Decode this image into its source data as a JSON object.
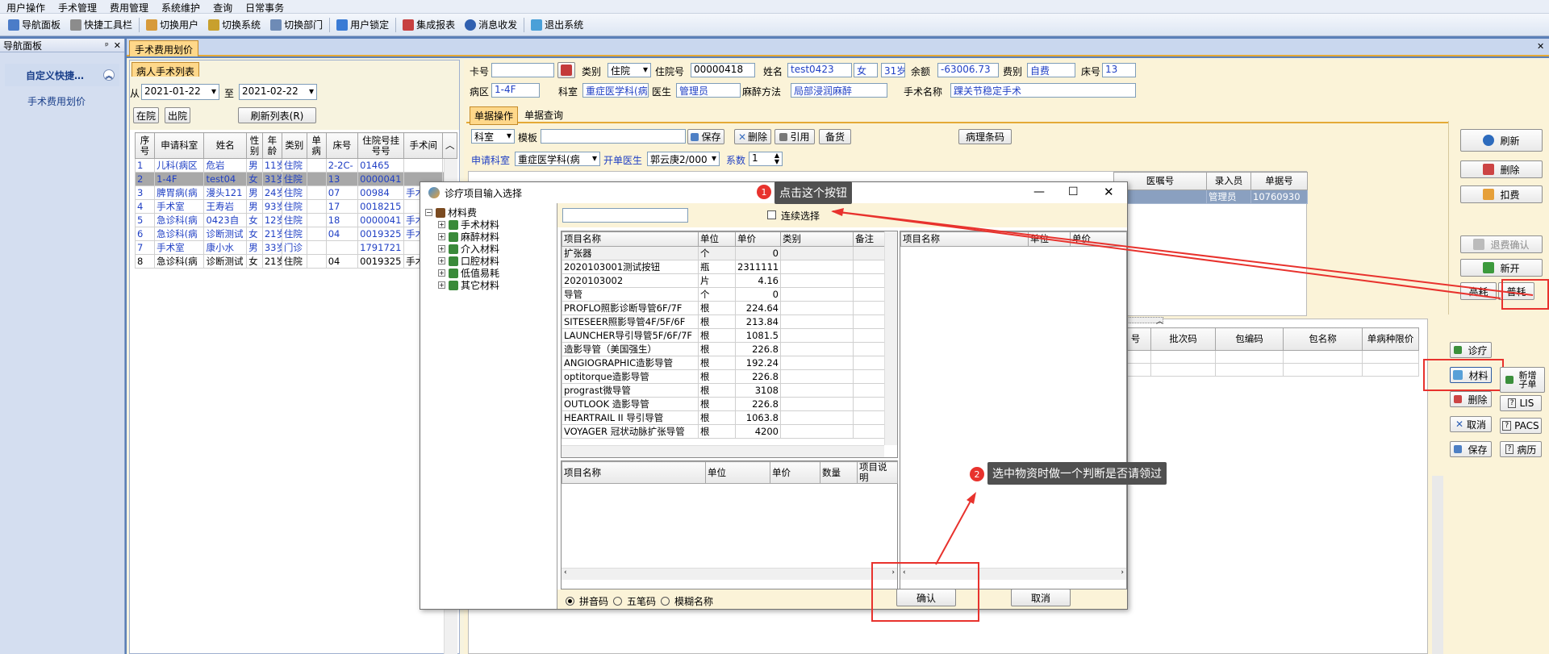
{
  "menu": [
    "用户操作",
    "手术管理",
    "费用管理",
    "系统维护",
    "查询",
    "日常事务"
  ],
  "toolbar": [
    "导航面板",
    "快捷工具栏",
    "切换用户",
    "切换系统",
    "切换部门",
    "用户锁定",
    "集成报表",
    "消息收发",
    "退出系统"
  ],
  "nav": {
    "title": "导航面板",
    "pin": "ᵖ",
    "close": "✕",
    "group": "自定义快捷…",
    "item": "手术费用划价"
  },
  "main_tab": "手术费用划价",
  "left": {
    "tab": "病人手术列表",
    "from_label": "从",
    "from_date": "2021-01-22",
    "to_label": "至",
    "to_date": "2021-02-22",
    "btn_inpatient": "在院",
    "btn_discharged": "出院",
    "btn_refresh": "刷新列表(R)",
    "columns": [
      "序号",
      "申请科室",
      "姓名",
      "性别",
      "年龄",
      "类别",
      "单病",
      "床号",
      "住院号挂号号",
      "手术间"
    ],
    "rows": [
      [
        "1",
        "儿科(病区",
        "危岩",
        "男",
        "11岁",
        "住院",
        "",
        "2-2C-",
        "01465",
        ""
      ],
      [
        "2",
        "1-4F",
        "test04",
        "女",
        "31岁",
        "住院",
        "",
        "13",
        "0000041",
        ""
      ],
      [
        "3",
        "脾胃病(病",
        "漫头121",
        "男",
        "24岁",
        "住院",
        "",
        "07",
        "00984",
        "手术"
      ],
      [
        "4",
        "手术室",
        "王寿岩",
        "男",
        "93岁",
        "住院",
        "",
        "17",
        "0018215",
        ""
      ],
      [
        "5",
        "急诊科(病",
        "0423自",
        "女",
        "12岁",
        "住院",
        "",
        "18",
        "0000041",
        "手术"
      ],
      [
        "6",
        "急诊科(病",
        "诊断测试",
        "女",
        "21岁",
        "住院",
        "",
        "04",
        "0019325",
        "手术"
      ],
      [
        "7",
        "手术室",
        "康小水",
        "男",
        "33岁",
        "门诊",
        "",
        "",
        "1791721",
        ""
      ],
      [
        "8",
        "急诊科(病",
        "诊断测试",
        "女",
        "21岁",
        "住院",
        "",
        "04",
        "0019325",
        "手术"
      ]
    ]
  },
  "patient": {
    "card_label": "卡号",
    "card": "",
    "type_label": "类别",
    "type": "住院",
    "inpatient_no_label": "住院号",
    "inpatient_no": "00000418",
    "name_label": "姓名",
    "name": "test0423",
    "sex": "女",
    "age": "31岁",
    "balance_label": "余额",
    "balance": "-63006.73",
    "fee_type_label": "费别",
    "fee_type": "自费",
    "bed_label": "床号",
    "bed": "13",
    "ward_label": "病区",
    "ward": "1-4F",
    "dept_label": "科室",
    "dept": "重症医学科(病区",
    "doctor_label": "医生",
    "doctor": "管理员",
    "anes_label": "麻醉方法",
    "anes": "局部浸润麻醉",
    "surgery_label": "手术名称",
    "surgery": "踝关节稳定手术"
  },
  "subtabs": [
    "单据操作",
    "单据查询"
  ],
  "ops": {
    "dept_select": "科室",
    "template_label": "模板",
    "save": "保存",
    "delete": "删除",
    "cite": "引用",
    "backup": "备货",
    "path_barcode": "病理条码",
    "apply_dept_label": "申请科室",
    "apply_dept": "重症医学科(病",
    "open_doctor_label": "开单医生",
    "open_doctor": "郭云庚2/000",
    "coef_label": "系数",
    "coef": "1"
  },
  "upper_grid": {
    "columns": [
      "医嘱号",
      "录入员",
      "单据号"
    ],
    "row": [
      "",
      "管理员",
      "10760930"
    ]
  },
  "lower_grid": {
    "columns": [
      "号",
      "批次码",
      "包编码",
      "包名称",
      "单病种限价"
    ]
  },
  "right_buttons": {
    "refresh": "刷新",
    "delete": "删除",
    "deduct": "扣费",
    "return_confirm": "退费确认",
    "new": "新开",
    "high_consume": "高耗",
    "normal_consume": "普耗"
  },
  "bottom_buttons": {
    "diag": "诊疗",
    "material": "材料",
    "add_sub": "新增子单",
    "delete": "删除",
    "lis": "LIS",
    "cancel": "取消",
    "pacs": "PACS",
    "save": "保存",
    "history": "病历"
  },
  "dialog": {
    "title": "诊疗项目输入选择",
    "continuous_select": "连续选择",
    "tree_root": "材料费",
    "tree_children": [
      "手术材料",
      "麻醉材料",
      "介入材料",
      "口腔材料",
      "低值易耗",
      "其它材料"
    ],
    "item_columns": [
      "项目名称",
      "单位",
      "单价",
      "类别",
      "备注"
    ],
    "items": [
      [
        "扩张器",
        "个",
        "0",
        "",
        ""
      ],
      [
        "2020103001测试按钮",
        "瓶",
        "2311111",
        "",
        ""
      ],
      [
        "2020103002",
        "片",
        "4.16",
        "",
        ""
      ],
      [
        "导管",
        "个",
        "0",
        "",
        ""
      ],
      [
        "PROFLO照影诊断导管6F/7F",
        "根",
        "224.64",
        "",
        ""
      ],
      [
        "SITESEER照影导管4F/5F/6F",
        "根",
        "213.84",
        "",
        ""
      ],
      [
        "LAUNCHER导引导管5F/6F/7F",
        "根",
        "1081.5",
        "",
        ""
      ],
      [
        "造影导管（美国强生）",
        "根",
        "226.8",
        "",
        ""
      ],
      [
        "ANGIOGRAPHIC造影导管",
        "根",
        "192.24",
        "",
        ""
      ],
      [
        "optitorque造影导管",
        "根",
        "226.8",
        "",
        ""
      ],
      [
        "prograst微导管",
        "根",
        "3108",
        "",
        ""
      ],
      [
        "OUTLOOK 造影导管",
        "根",
        "226.8",
        "",
        ""
      ],
      [
        "HEARTRAIL II 导引导管",
        "根",
        "1063.8",
        "",
        ""
      ],
      [
        "VOYAGER 冠状动脉扩张导管",
        "根",
        "4200",
        "",
        ""
      ]
    ],
    "selected_columns": [
      "项目名称",
      "单位",
      "单价",
      "数量",
      "项目说明"
    ],
    "right_columns": [
      "项目名称",
      "单位",
      "单价"
    ],
    "radio": [
      "拼音码",
      "五笔码",
      "模糊名称"
    ],
    "ok": "确认",
    "cancel": "取消"
  },
  "annotations": {
    "a1_num": "1",
    "a1_text": "点击这个按钮",
    "a2_num": "2",
    "a2_text": "选中物资时做一个判断是否请领过",
    "color": "#e8322d"
  }
}
